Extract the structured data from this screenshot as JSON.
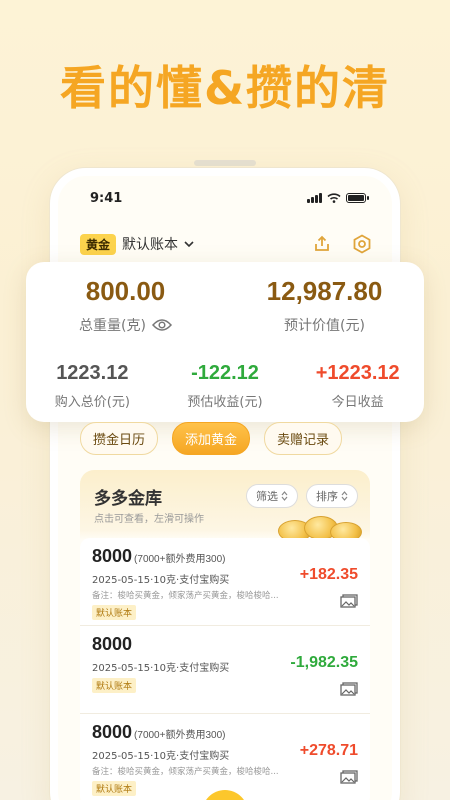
{
  "headline": "看的懂&攒的清",
  "status": {
    "time": "9:41"
  },
  "header": {
    "tag": "黄金",
    "account": "默认账本"
  },
  "summary": {
    "total_weight": "800.00",
    "total_weight_label": "总重量(克)",
    "est_value": "12,987.80",
    "est_value_label": "预计价值(元)",
    "purchase_total": "1223.12",
    "purchase_total_label": "购入总价(元)",
    "est_profit": "-122.12",
    "est_profit_label": "预估收益(元)",
    "today_profit": "+1223.12",
    "today_profit_label": "今日收益"
  },
  "tabs": [
    {
      "label": "攒金日历"
    },
    {
      "label": "添加黄金"
    },
    {
      "label": "卖赠记录"
    }
  ],
  "vault": {
    "title": "多多金库",
    "subtitle": "点击可查看，左滑可操作",
    "filter": "筛选",
    "sort": "排序"
  },
  "items": [
    {
      "amount": "8000",
      "extra": "(7000+额外费用300)",
      "line": "2025-05-15·10克·支付宝购买",
      "note": "备注：梭哈买黄金，倾家荡产买黄金，梭哈梭哈...",
      "badge": "默认账本",
      "profit": "+182.35"
    },
    {
      "amount": "8000",
      "extra": "",
      "line": "2025-05-15·10克·支付宝购买",
      "note": "",
      "badge": "默认账本",
      "profit": "-1,982.35"
    },
    {
      "amount": "8000",
      "extra": "(7000+额外费用300)",
      "line": "2025-05-15·10克·支付宝购买",
      "note": "备注：梭哈买黄金，倾家荡产买黄金，梭哈梭哈...",
      "badge": "默认账本",
      "profit": "+278.71"
    }
  ],
  "colors": {
    "accent": "#f5a623",
    "gain": "#ef4b2c",
    "loss": "#2faa3c"
  }
}
